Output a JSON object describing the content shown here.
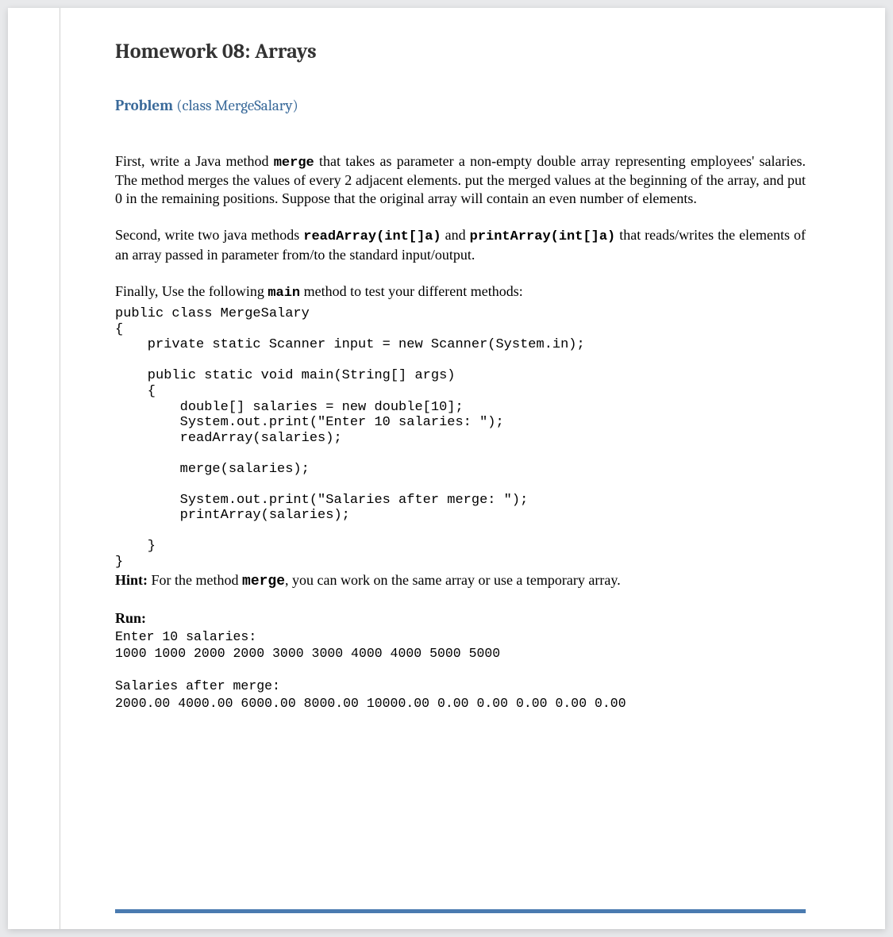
{
  "title": "Homework 08: Arrays",
  "problem": {
    "label": "Problem ",
    "class": "(class MergeSalary)"
  },
  "p1": {
    "t1": "First, write a Java method ",
    "m1": "merge",
    "t2": " that takes as parameter a non-empty double array representing employees' salaries. The method merges the values of every 2 adjacent elements. put the merged values at the beginning of the array, and put 0 in the remaining positions. Suppose that the original array will contain an even number of elements."
  },
  "p2": {
    "t1": "Second, write two java methods ",
    "m1": "readArray(int[]a)",
    "t2": " and ",
    "m2": "printArray(int[]a)",
    "t3": " that reads/writes the elements of an array passed in parameter from/to the standard input/output."
  },
  "p3": {
    "t1": "Finally, Use the following ",
    "m1": "main",
    "t2": " method to test your different methods:"
  },
  "code": "public class MergeSalary\n{\n    private static Scanner input = new Scanner(System.in);\n\n    public static void main(String[] args)\n    {\n        double[] salaries = new double[10];\n        System.out.print(\"Enter 10 salaries: \");\n        readArray(salaries);\n\n        merge(salaries);\n\n        System.out.print(\"Salaries after merge: \");\n        printArray(salaries);\n\n    }\n}",
  "hint": {
    "label": "Hint:",
    "t1": " For the method ",
    "m1": "merge",
    "t2": ", you can work on the same array or use a temporary array."
  },
  "run": {
    "heading": "Run:",
    "block1": "Enter 10 salaries:\n1000 1000 2000 2000 3000 3000 4000 4000 5000 5000",
    "block2": "Salaries after merge:\n2000.00 4000.00 6000.00 8000.00 10000.00 0.00 0.00 0.00 0.00 0.00"
  }
}
